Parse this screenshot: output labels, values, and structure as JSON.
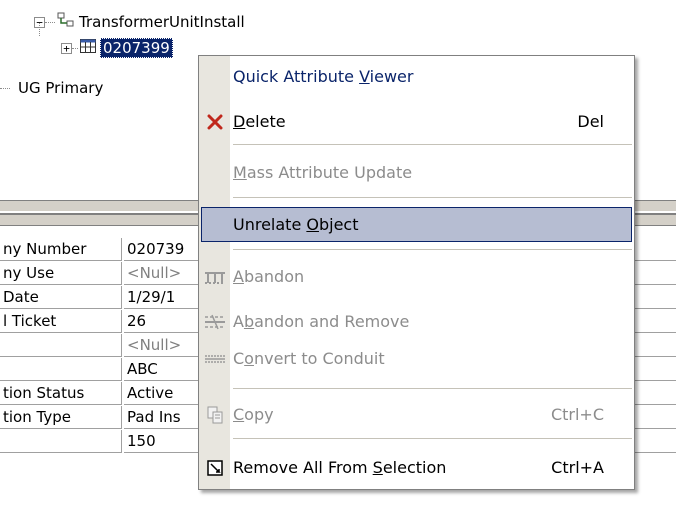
{
  "tree": {
    "parent_label": "TransformerUnitInstall",
    "child_label": "0207399",
    "sibling_label": "UG Primary",
    "expander_minus": "−",
    "expander_plus": "+"
  },
  "grid": {
    "rows": [
      {
        "label": "ny Number",
        "value": "020739"
      },
      {
        "label": "ny Use",
        "value": "<Null>"
      },
      {
        "label": "Date",
        "value": "1/29/1"
      },
      {
        "label": "l Ticket",
        "value": "26"
      },
      {
        "label": "",
        "value": "<Null>"
      },
      {
        "label": "",
        "value": "ABC"
      },
      {
        "label": "tion Status",
        "value": "Active"
      },
      {
        "label": "tion Type",
        "value": "Pad Ins"
      },
      {
        "label": "",
        "value": "150"
      }
    ]
  },
  "context_menu": {
    "quick_attr": {
      "pre": "Quick Attribute ",
      "acc": "V",
      "post": "iewer"
    },
    "delete": {
      "pre": "",
      "acc": "D",
      "post": "elete",
      "shortcut": "Del"
    },
    "mass_update": {
      "pre": "",
      "acc": "M",
      "post": "ass Attribute Update"
    },
    "unrelate": {
      "pre": "Unrelate ",
      "acc": "O",
      "post": "bject"
    },
    "abandon": {
      "pre": "",
      "acc": "A",
      "post": "bandon"
    },
    "abandon_remove": {
      "pre": "A",
      "acc": "b",
      "post": "andon and Remove"
    },
    "convert": {
      "pre": "C",
      "acc": "o",
      "post": "nvert to Conduit"
    },
    "copy": {
      "pre": "",
      "acc": "C",
      "post": "opy",
      "shortcut": "Ctrl+C"
    },
    "remove_all": {
      "pre": "Remove All From ",
      "acc": "S",
      "post": "election",
      "shortcut": "Ctrl+A"
    }
  },
  "colors": {
    "selection": "#0a246a",
    "menu_highlight": "#b6bdd2",
    "delete_icon": "#c0281c",
    "disabled_text": "#8c8c8c"
  }
}
